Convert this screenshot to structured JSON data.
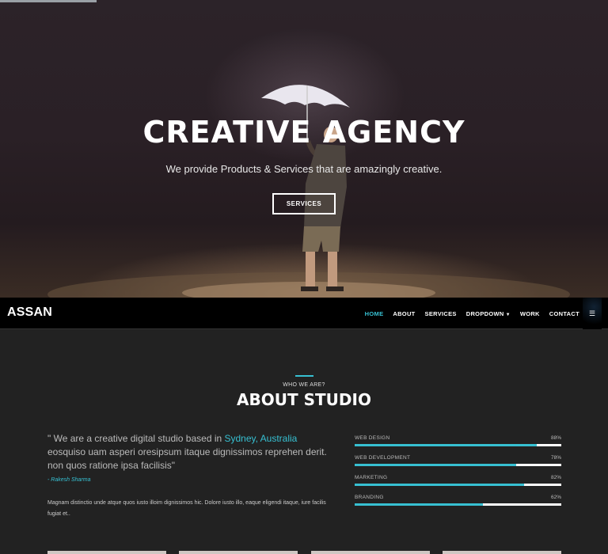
{
  "hero": {
    "title": "CREATIVE AGENCY",
    "subtitle": "We provide Products & Services that are amazingly creative.",
    "button_label": "SERVICES"
  },
  "navbar": {
    "brand": "ASSAN",
    "items": [
      {
        "label": "HOME",
        "active": true
      },
      {
        "label": "ABOUT",
        "active": false
      },
      {
        "label": "SERVICES",
        "active": false
      },
      {
        "label": "DROPDOWN",
        "active": false,
        "has_caret": true
      },
      {
        "label": "WORK",
        "active": false
      },
      {
        "label": "CONTACT",
        "active": false
      }
    ],
    "menu_icon": "list-icon",
    "accent_color": "#37c0d2"
  },
  "about": {
    "eyebrow": "WHO WE ARE?",
    "title": "ABOUT STUDIO",
    "quote_before": "\" We are a creative digital studio based in ",
    "quote_highlight": "Sydney, Australia",
    "quote_after": " eosquiso uam asperi oresipsum itaque dignissimos reprehen derit. non quos ratione ipsa facilisis\"",
    "author": "- Rakesh Sharma",
    "body": "Magnam distinctio unde atque quos iusto illoim dignissimos hic. Dolore iusto illo, eaque eligendi itaque, iure facilis fugiat et..",
    "skills": [
      {
        "label": "WEB DESIGN",
        "percent_label": "88%",
        "value": 88
      },
      {
        "label": "WEB DEVELOPMENT",
        "percent_label": "78%",
        "value": 78
      },
      {
        "label": "MARKETING",
        "percent_label": "82%",
        "value": 82
      },
      {
        "label": "BRANDING",
        "percent_label": "62%",
        "value": 62
      }
    ]
  }
}
